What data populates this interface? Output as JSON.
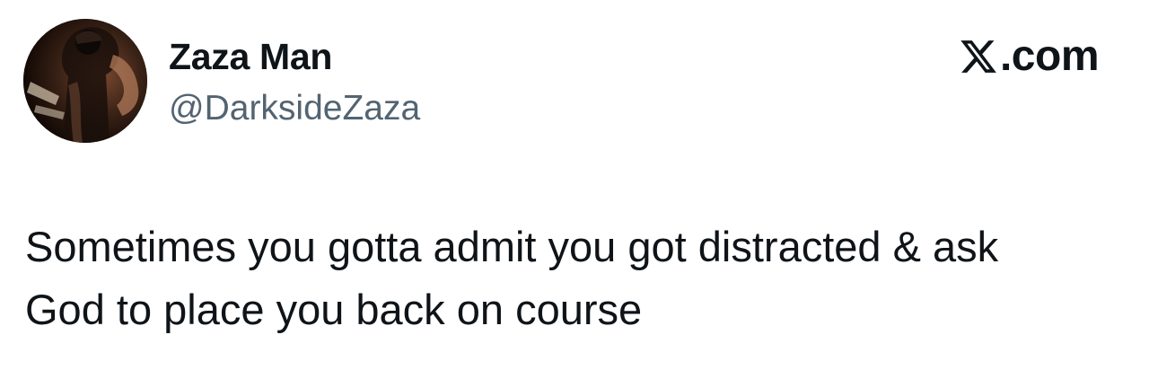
{
  "author": {
    "display_name": "Zaza Man",
    "handle": "@DarksideZaza",
    "avatar_icon": "profile-photo"
  },
  "brand": {
    "icon": "x-logo-icon",
    "label": ".com"
  },
  "tweet": {
    "lines": [
      "Sometimes you gotta admit you got distracted & ask",
      "God to place you back on course"
    ]
  },
  "colors": {
    "text": "#0f1419",
    "handle": "#536471",
    "background": "#ffffff"
  }
}
